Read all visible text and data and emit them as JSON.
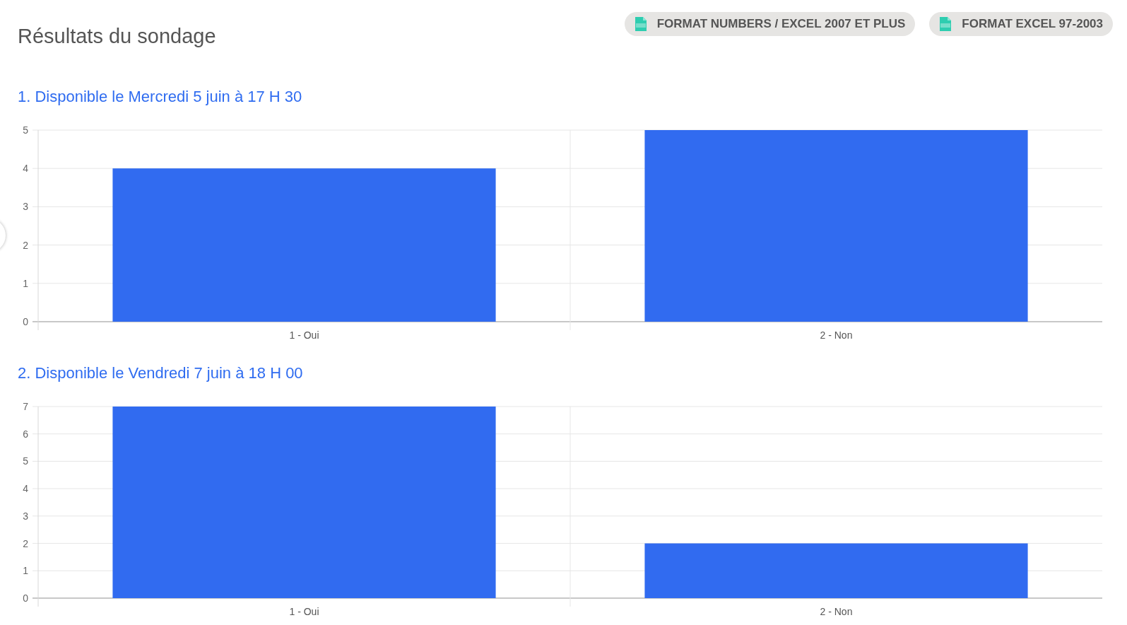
{
  "page_title": "Résultats du sondage",
  "export_buttons": [
    {
      "label": "FORMAT NUMBERS / EXCEL 2007 ET PLUS"
    },
    {
      "label": "FORMAT EXCEL 97-2003"
    }
  ],
  "questions": [
    {
      "title": "1. Disponible le Mercredi 5 juin à 17 H 30",
      "chart_data": {
        "type": "bar",
        "categories": [
          "1 - Oui",
          "2 - Non"
        ],
        "series": [
          {
            "color": "#316bf0",
            "values": [
              4,
              5
            ]
          }
        ],
        "grid": true,
        "ylim": [
          0,
          5
        ],
        "yticks": [
          0,
          1,
          2,
          3,
          4,
          5
        ]
      }
    },
    {
      "title": "2. Disponible le Vendredi 7 juin à 18 H 00",
      "chart_data": {
        "type": "bar",
        "categories": [
          "1 - Oui",
          "2 - Non"
        ],
        "series": [
          {
            "color": "#316bf0",
            "values": [
              7,
              2
            ]
          }
        ],
        "grid": true,
        "ylim": [
          0,
          7
        ],
        "yticks": [
          0,
          1,
          2,
          3,
          4,
          5,
          6,
          7
        ]
      }
    }
  ]
}
